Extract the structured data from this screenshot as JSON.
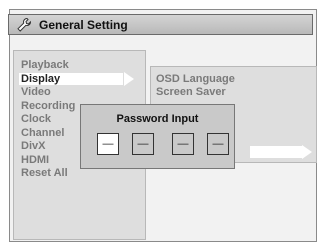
{
  "header": {
    "title": "General Setting",
    "icon": "wrench-icon"
  },
  "menu": {
    "items": [
      {
        "label": "Playback"
      },
      {
        "label": "Display",
        "selected": true
      },
      {
        "label": "Video"
      },
      {
        "label": "Recording"
      },
      {
        "label": "Clock"
      },
      {
        "label": "Channel"
      },
      {
        "label": "DivX"
      },
      {
        "label": "HDMI"
      },
      {
        "label": "Reset All"
      }
    ]
  },
  "submenu": {
    "items": [
      {
        "label": "OSD Language"
      },
      {
        "label": "Screen Saver"
      }
    ]
  },
  "dialog": {
    "title": "Password Input",
    "digits": [
      "—",
      "—",
      "—",
      "—"
    ]
  },
  "colors": {
    "panel": "#dedede",
    "highlight": "#ffffff",
    "text_dim": "#7a7a7a"
  }
}
